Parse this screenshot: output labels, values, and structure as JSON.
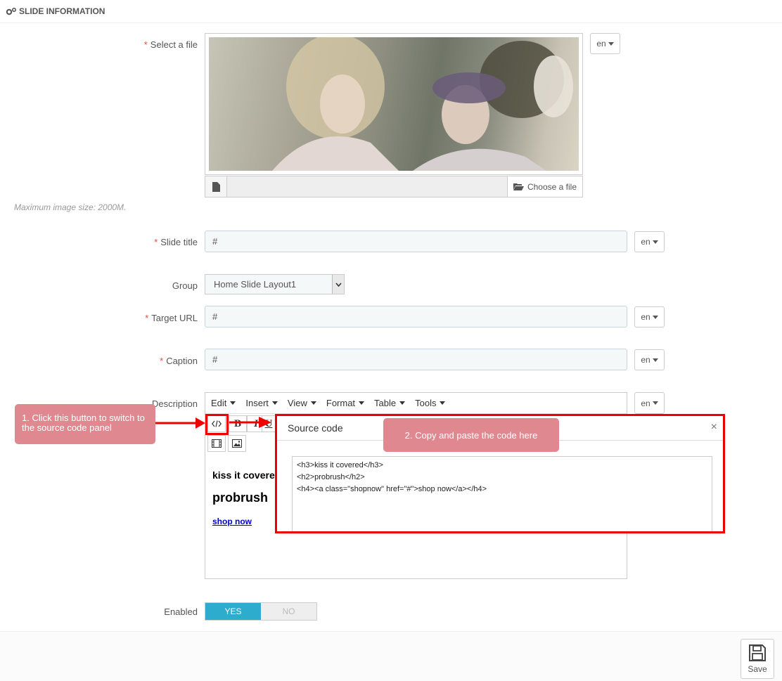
{
  "panel": {
    "title": "SLIDE INFORMATION"
  },
  "required_mark": "*",
  "fields": {
    "select_file": {
      "label": "Select a file",
      "lang": "en",
      "choose_label": "Choose a file",
      "hint": "Maximum image size: 2000M."
    },
    "slide_title": {
      "label": "Slide title",
      "value": "#",
      "lang": "en"
    },
    "group": {
      "label": "Group",
      "value": "Home Slide Layout1"
    },
    "target_url": {
      "label": "Target URL",
      "value": "#",
      "lang": "en"
    },
    "caption": {
      "label": "Caption",
      "value": "#",
      "lang": "en"
    },
    "description": {
      "label": "Description",
      "lang": "en",
      "menu": [
        "Edit",
        "Insert",
        "View",
        "Format",
        "Table",
        "Tools"
      ],
      "toolbar": {
        "bold": "B",
        "italic": "I",
        "underline": "U"
      },
      "content": {
        "h3": "kiss it covered",
        "h2": "probrush",
        "link": "shop now"
      }
    },
    "enabled": {
      "label": "Enabled",
      "yes": "YES",
      "no": "NO"
    }
  },
  "source_dialog": {
    "title": "Source code",
    "close": "×",
    "code": "<h3>kiss it covered</h3>\n<h2>probrush</h2>\n<h4><a class=\"shopnow\" href=\"#\">shop now</a></h4>"
  },
  "callouts": {
    "step1": "1. Click this button to switch to the source code panel",
    "step2": "2. Copy and paste the code here"
  },
  "footer": {
    "save_label": "Save"
  },
  "colors": {
    "accent": "#2eacce",
    "required": "#e74c3c",
    "annotation": "#e00000",
    "callout": "#e08890"
  }
}
